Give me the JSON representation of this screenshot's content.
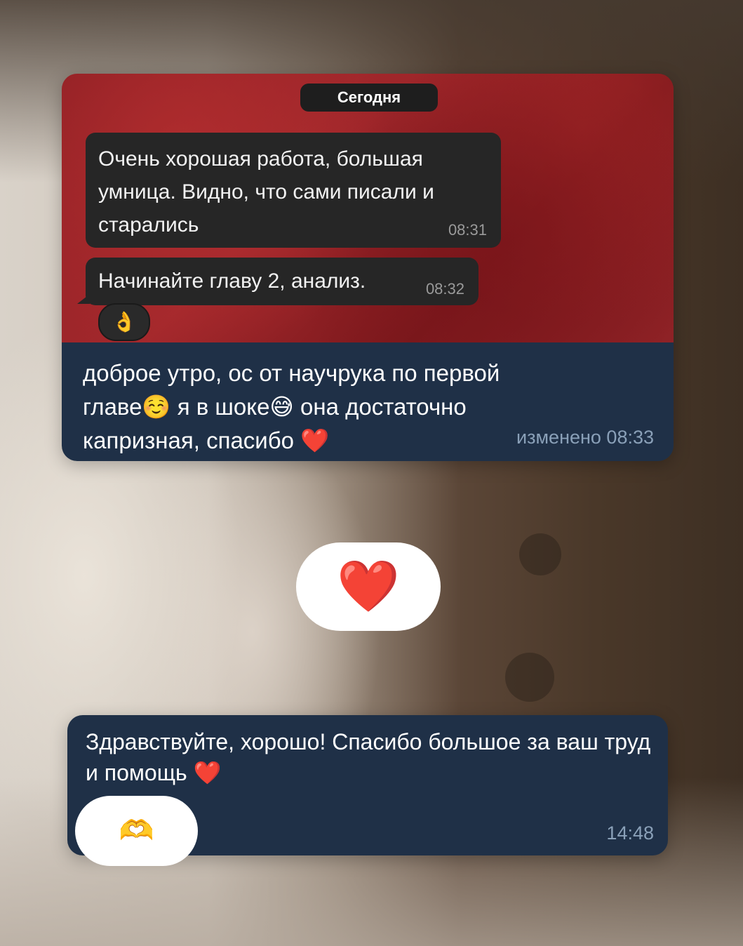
{
  "date_separator": "Сегодня",
  "messages": [
    {
      "text": "Очень хорошая работа, большая умница. Видно, что сами писали и старались",
      "time": "08:31"
    },
    {
      "text": "Начинайте главу 2, анализ.",
      "time": "08:32",
      "reaction": "👌"
    }
  ],
  "reply": {
    "text": "доброе утро, ос от научрука по первой главе☺️ я в шоке😅 она достаточно капризная, спасибо ❤️",
    "status": "изменено 08:33"
  },
  "heart_reaction": "❤️",
  "final_message": {
    "text": "Здравствуйте, хорошо! Спасибо большое за ваш труд и помощь ❤️",
    "time": "14:48",
    "reaction": "🫶"
  },
  "colors": {
    "reply_bubble": "#1f3047",
    "dark_bubble": "#262626",
    "heart": "#e21b2b"
  }
}
